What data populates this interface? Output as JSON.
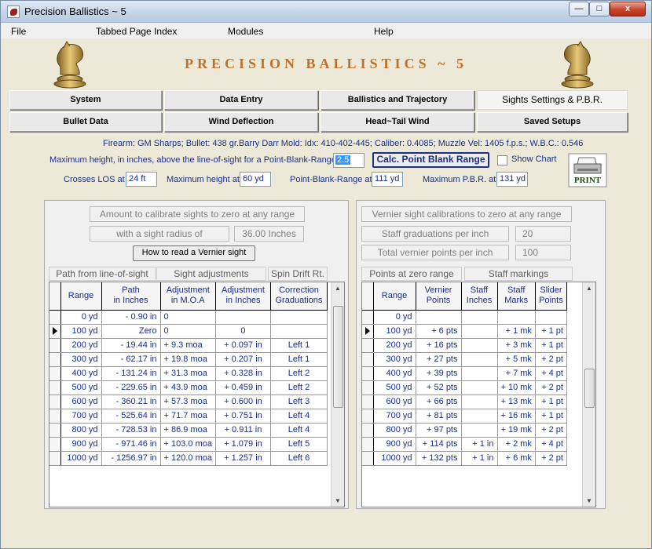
{
  "window": {
    "title": "Precision Ballistics ~ 5",
    "min_label": "—",
    "max_label": "□",
    "close_label": "x"
  },
  "menu": [
    "File",
    "Tabbed Page Index",
    "Modules",
    "Help"
  ],
  "app_title": "PRECISION BALLISTICS ~ 5",
  "tabs_row1": [
    "System",
    "Data Entry",
    "Ballistics and Trajectory",
    "Sights Settings & P.B.R."
  ],
  "tabs_row2": [
    "Bullet Data",
    "Wind Deflection",
    "Head~Tail Wind",
    "Saved Setups"
  ],
  "info_line": "Firearm: GM Sharps;   Bullet: 438 gr.Barry Darr Mold:   Idx: 410-402-445;   Caliber: 0.4085;   Muzzle Vel: 1405 f.p.s.;   W.B.C.: 0.546",
  "pbr": {
    "max_height_label": "Maximum height, in inches, above the line-of-sight for a Point-Blank-Range",
    "max_height_value": "2.5",
    "calc_button": "Calc. Point Blank Range",
    "show_chart_label": "Show Chart",
    "crosses_los_label": "Crosses LOS at",
    "crosses_los_value": "24 ft",
    "max_height_at_label": "Maximum height at",
    "max_height_at_value": "60 yd",
    "pbr_at_label": "Point-Blank-Range at",
    "pbr_at_value": "111 yd",
    "max_pbr_label": "Maximum P.B.R. at",
    "max_pbr_value": "131 yd",
    "print_label": "PRINT"
  },
  "left": {
    "calibrate_title": "Amount to calibrate  sights to zero at any range",
    "sight_radius_label": "with  a sight radius of",
    "sight_radius_value": "36.00 Inches",
    "vernier_button": "How to read a Vernier sight",
    "section_path": "Path from line-of-sight",
    "section_adjust": "Sight adjustments",
    "section_spin": "Spin Drift Rt.",
    "headers": [
      "Range",
      "Path\nin Inches",
      "Adjustment\nin M.O.A",
      "Adjustment\nin Inches",
      "Correction\nGraduations"
    ],
    "rows": [
      [
        "0 yd",
        "- 0.90 in",
        "0",
        "",
        ""
      ],
      [
        "100 yd",
        "Zero",
        "0",
        "0",
        ""
      ],
      [
        "200 yd",
        "- 19.44 in",
        "+ 9.3  moa",
        "+ 0.097 in",
        "Left  1"
      ],
      [
        "300 yd",
        "- 62.17 in",
        "+ 19.8  moa",
        "+ 0.207 in",
        "Left  1"
      ],
      [
        "400 yd",
        "- 131.24 in",
        "+ 31.3  moa",
        "+ 0.328 in",
        "Left  2"
      ],
      [
        "500 yd",
        "- 229.65 in",
        "+ 43.9  moa",
        "+ 0.459 in",
        "Left  2"
      ],
      [
        "600 yd",
        "- 360.21 in",
        "+ 57.3  moa",
        "+ 0.600 in",
        "Left  3"
      ],
      [
        "700 yd",
        "- 525.64 in",
        "+ 71.7  moa",
        "+ 0.751 in",
        "Left  4"
      ],
      [
        "800 yd",
        "- 728.53 in",
        "+ 86.9  moa",
        "+ 0.911 in",
        "Left  4"
      ],
      [
        "900 yd",
        "- 971.46 in",
        "+ 103.0  moa",
        "+ 1.079 in",
        "Left  5"
      ],
      [
        "1000 yd",
        "- 1256.97 in",
        "+ 120.0  moa",
        "+ 1.257 in",
        "Left  6"
      ]
    ]
  },
  "right": {
    "vernier_title": "Vernier sight  calibrations to zero at any range",
    "staff_grad_label": "Staff graduations per inch",
    "staff_grad_value": "20",
    "total_vernier_label": "Total  vernier points  per inch",
    "total_vernier_value": "100",
    "section_points": "Points at zero range",
    "section_staff": "Staff  markings",
    "headers": [
      "Range",
      "Vernier\nPoints",
      "Staff\nInches",
      "Staff\nMarks",
      "Slider\nPoints"
    ],
    "rows": [
      [
        "0 yd",
        "",
        "",
        "",
        ""
      ],
      [
        "100 yd",
        "+ 6  pts",
        "",
        "+ 1 mk",
        "+ 1 pt"
      ],
      [
        "200 yd",
        "+ 16  pts",
        "",
        "+ 3 mk",
        "+ 1 pt"
      ],
      [
        "300 yd",
        "+ 27  pts",
        "",
        "+ 5 mk",
        "+ 2 pt"
      ],
      [
        "400 yd",
        "+ 39  pts",
        "",
        "+ 7 mk",
        "+ 4 pt"
      ],
      [
        "500 yd",
        "+ 52  pts",
        "",
        "+ 10 mk",
        "+ 2 pt"
      ],
      [
        "600 yd",
        "+ 66  pts",
        "",
        "+ 13 mk",
        "+ 1 pt"
      ],
      [
        "700 yd",
        "+ 81  pts",
        "",
        "+ 16 mk",
        "+ 1 pt"
      ],
      [
        "800 yd",
        "+ 97  pts",
        "",
        "+ 19 mk",
        "+ 2 pt"
      ],
      [
        "900 yd",
        "+ 114  pts",
        "+ 1 in",
        "+ 2 mk",
        "+ 4 pt"
      ],
      [
        "1000 yd",
        "+ 132  pts",
        "+ 1 in",
        "+ 6 mk",
        "+ 2 pt"
      ]
    ]
  },
  "current_row_index": 1,
  "colors": {
    "title_accent": "#c0702a",
    "text_blue": "#1a2f8a"
  }
}
